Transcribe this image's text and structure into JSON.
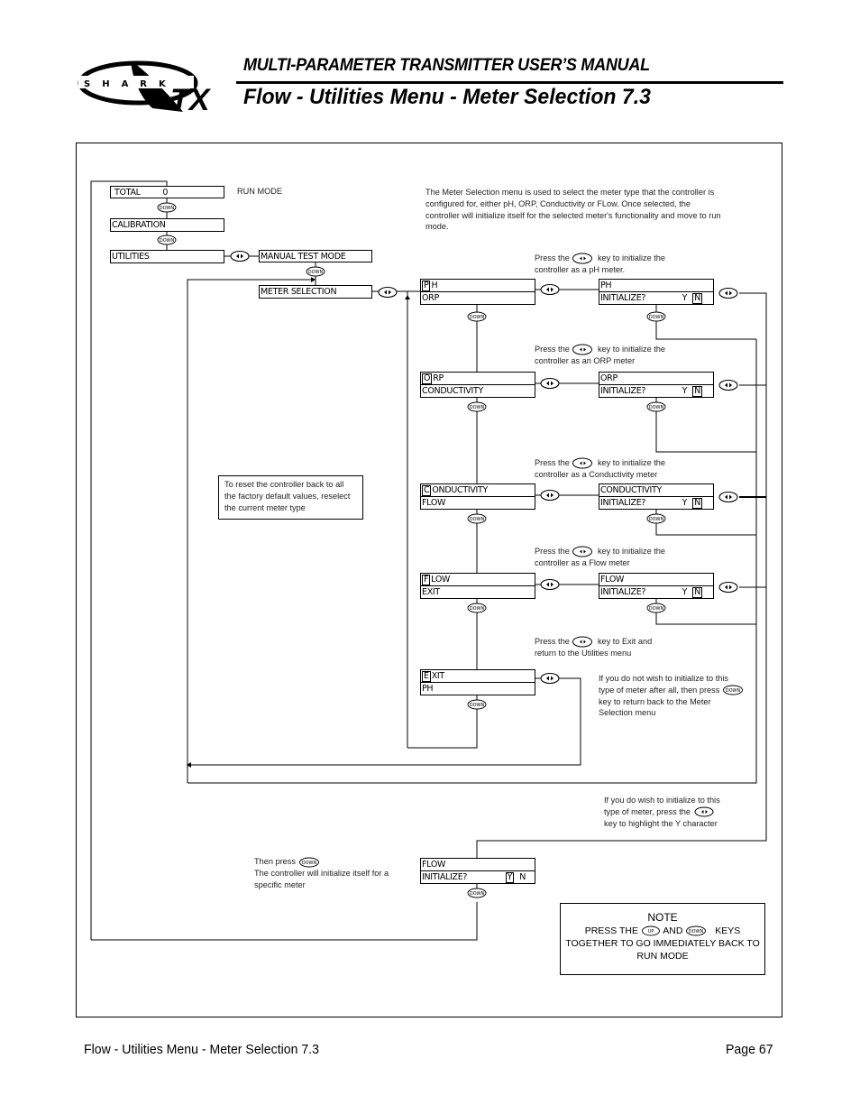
{
  "header": {
    "logo_text_top": "SHARK",
    "logo_text_bottom": "TX",
    "manual_title": "MULTI-PARAMETER TRANSMITTER USER’S MANUAL",
    "page_title": "Flow - Utilities Menu - Meter Selection 7.3"
  },
  "diagram": {
    "main_menu": {
      "total_label": "TOTAL",
      "total_value": "0",
      "run_mode_label": "RUN MODE",
      "calibration": "CALIBRATION",
      "utilities": "UTILITIES",
      "manual_test_mode": "MANUAL TEST MODE",
      "meter_selection": "METER SELECTION"
    },
    "intro_text": "The Meter Selection menu is used to select the meter type that the controller is configured for, either pH, ORP, Conductivity or FLow. Once selected, the controller will initialize itself for the selected meter's functionality and move to run mode.",
    "meter_rows": [
      {
        "cursor": "P",
        "rest": "H",
        "next": "ORP",
        "hint_pre": "Press the",
        "hint_post": "key to initialize the",
        "hint_line2": "controller as a pH meter.",
        "confirm_title": "PH",
        "confirm_prompt": "INITIALIZE?",
        "yes": "Y",
        "no": "N"
      },
      {
        "cursor": "O",
        "rest": "RP",
        "next": "CONDUCTIVITY",
        "hint_pre": "Press the",
        "hint_post": "key to initialize the",
        "hint_line2": "controller as an ORP meter",
        "confirm_title": "ORP",
        "confirm_prompt": "INITIALIZE?",
        "yes": "Y",
        "no": "N"
      },
      {
        "cursor": "C",
        "rest": "ONDUCTIVITY",
        "next": "FLOW",
        "hint_pre": "Press the",
        "hint_post": "key to initialize the",
        "hint_line2": "controller as a Conductivity meter",
        "confirm_title": "CONDUCTIVITY",
        "confirm_prompt": "INITIALIZE?",
        "yes": "Y",
        "no": "N"
      },
      {
        "cursor": "F",
        "rest": "LOW",
        "next": "EXIT",
        "hint_pre": "Press the",
        "hint_post": "key to initialize the",
        "hint_line2": "controller as a Flow meter",
        "confirm_title": "FLOW",
        "confirm_prompt": "INITIALIZE?",
        "yes": "Y",
        "no": "N"
      }
    ],
    "exit_row": {
      "cursor": "E",
      "rest": "XIT",
      "next": "PH",
      "hint_pre": "Press the",
      "hint_post": "key to Exit and",
      "hint_line2": "return to the Utilities menu"
    },
    "no_init_text": {
      "line1": "If you do not wish to initialize to this",
      "line2_pre": "type of meter after all, then press",
      "line3": "key to return back to the Meter",
      "line4": "Selection menu"
    },
    "do_init_text": {
      "line1": "If you do wish to initialize to this",
      "line2_pre": "type of meter, press the",
      "line3": "key to highlight the Y character"
    },
    "final_confirm": {
      "title": "FLOW",
      "prompt": "INITIALIZE?",
      "yes": "Y",
      "no": "N"
    },
    "then_press_text": {
      "line1_pre": "Then press",
      "line2": "The controller will initialize itself for a",
      "line3": "specific meter"
    },
    "reset_note": "To reset the controller back to all the factory default values, reselect the current meter type",
    "note": {
      "title": "NOTE",
      "line1_pre": "PRESS THE",
      "line1_mid": "AND",
      "line1_post": "KEYS",
      "line2": "TOGETHER TO GO IMMEDIATELY BACK TO",
      "line3": "RUN MODE"
    },
    "keys": {
      "down_label": "DOWN",
      "up_label": "UP",
      "enter_icon": "left-right-arrow-key"
    }
  },
  "footer": {
    "section": "Flow - Utilities Menu - Meter Selection 7.3",
    "page": "Page 67"
  }
}
